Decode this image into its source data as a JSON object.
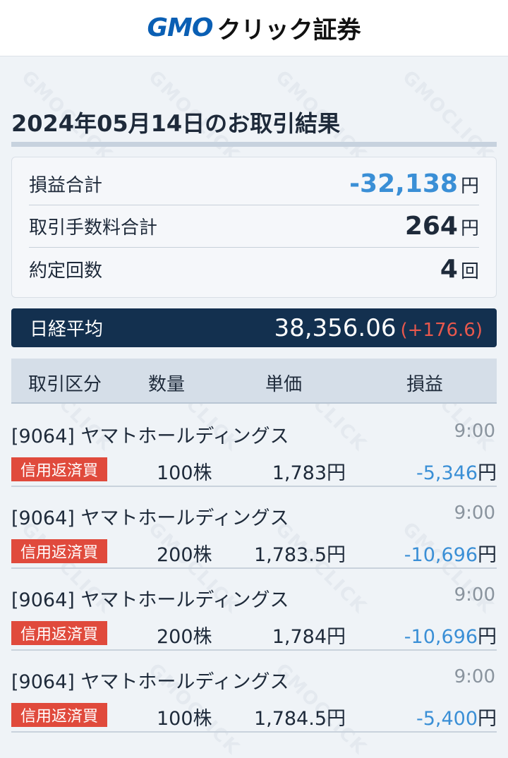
{
  "header": {
    "logo_gmo": "GMO",
    "logo_click": "クリック証券"
  },
  "title": "2024年05月14日のお取引結果",
  "summary": {
    "profit_label": "損益合計",
    "profit_value": "-32,138",
    "profit_unit": "円",
    "fee_label": "取引手数料合計",
    "fee_value": "264",
    "fee_unit": "円",
    "count_label": "約定回数",
    "count_value": "4",
    "count_unit": "回"
  },
  "nikkei": {
    "label": "日経平均",
    "value": "38,356.06",
    "change": "(+176.6)"
  },
  "table": {
    "headers": [
      "取引区分",
      "数量",
      "単価",
      "損益"
    ],
    "rows": [
      {
        "name": "[9064] ヤマトホールディングス",
        "time": "9:00",
        "type": "信用返済買",
        "qty": "100株",
        "price": "1,783円",
        "pnl": "-5,346",
        "pnl_unit": "円"
      },
      {
        "name": "[9064] ヤマトホールディングス",
        "time": "9:00",
        "type": "信用返済買",
        "qty": "200株",
        "price": "1,783.5円",
        "pnl": "-10,696",
        "pnl_unit": "円"
      },
      {
        "name": "[9064] ヤマトホールディングス",
        "time": "9:00",
        "type": "信用返済買",
        "qty": "200株",
        "price": "1,784円",
        "pnl": "-10,696",
        "pnl_unit": "円"
      },
      {
        "name": "[9064] ヤマトホールディングス",
        "time": "9:00",
        "type": "信用返済買",
        "qty": "100株",
        "price": "1,784.5円",
        "pnl": "-5,400",
        "pnl_unit": "円"
      }
    ]
  },
  "colors": {
    "brand_blue": "#0a5fb4",
    "navy": "#13304f",
    "negative": "#3a8fd6",
    "badge_red": "#e04a3c"
  }
}
